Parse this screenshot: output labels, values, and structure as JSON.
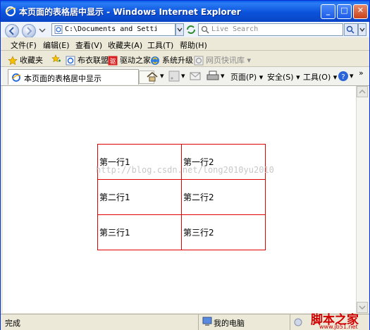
{
  "window": {
    "title": "本页面的表格居中显示 - Windows Internet Explorer"
  },
  "navbar": {
    "address": "C:\\Documents and Settings\\",
    "search_placeholder": "Live Search"
  },
  "menubar": {
    "items": [
      "文件(F)",
      "编辑(E)",
      "查看(V)",
      "收藏夹(A)",
      "工具(T)",
      "帮助(H)"
    ]
  },
  "favbar": {
    "favorites_label": "收藏夹",
    "items": [
      "布衣联盟",
      "驱动之家",
      "系统升级",
      "网页快讯库"
    ]
  },
  "tabbar": {
    "tab_label": "本页面的表格居中显示",
    "commands": [
      "页面(P)",
      "安全(S)",
      "工具(O)"
    ]
  },
  "table": {
    "rows": [
      [
        "第一行1",
        "第一行2"
      ],
      [
        "第二行1",
        "第二行2"
      ],
      [
        "第三行1",
        "第三行2"
      ]
    ]
  },
  "watermark": {
    "text": "http://blog.csdn.net/long2010yu2010"
  },
  "status": {
    "left": "完成",
    "zone": "我的电脑"
  },
  "logo": {
    "main": "脚本之家",
    "sub": "www.jb51.net"
  },
  "colors": {
    "table_border": "#e00000",
    "titlebar": "#0b53db"
  }
}
